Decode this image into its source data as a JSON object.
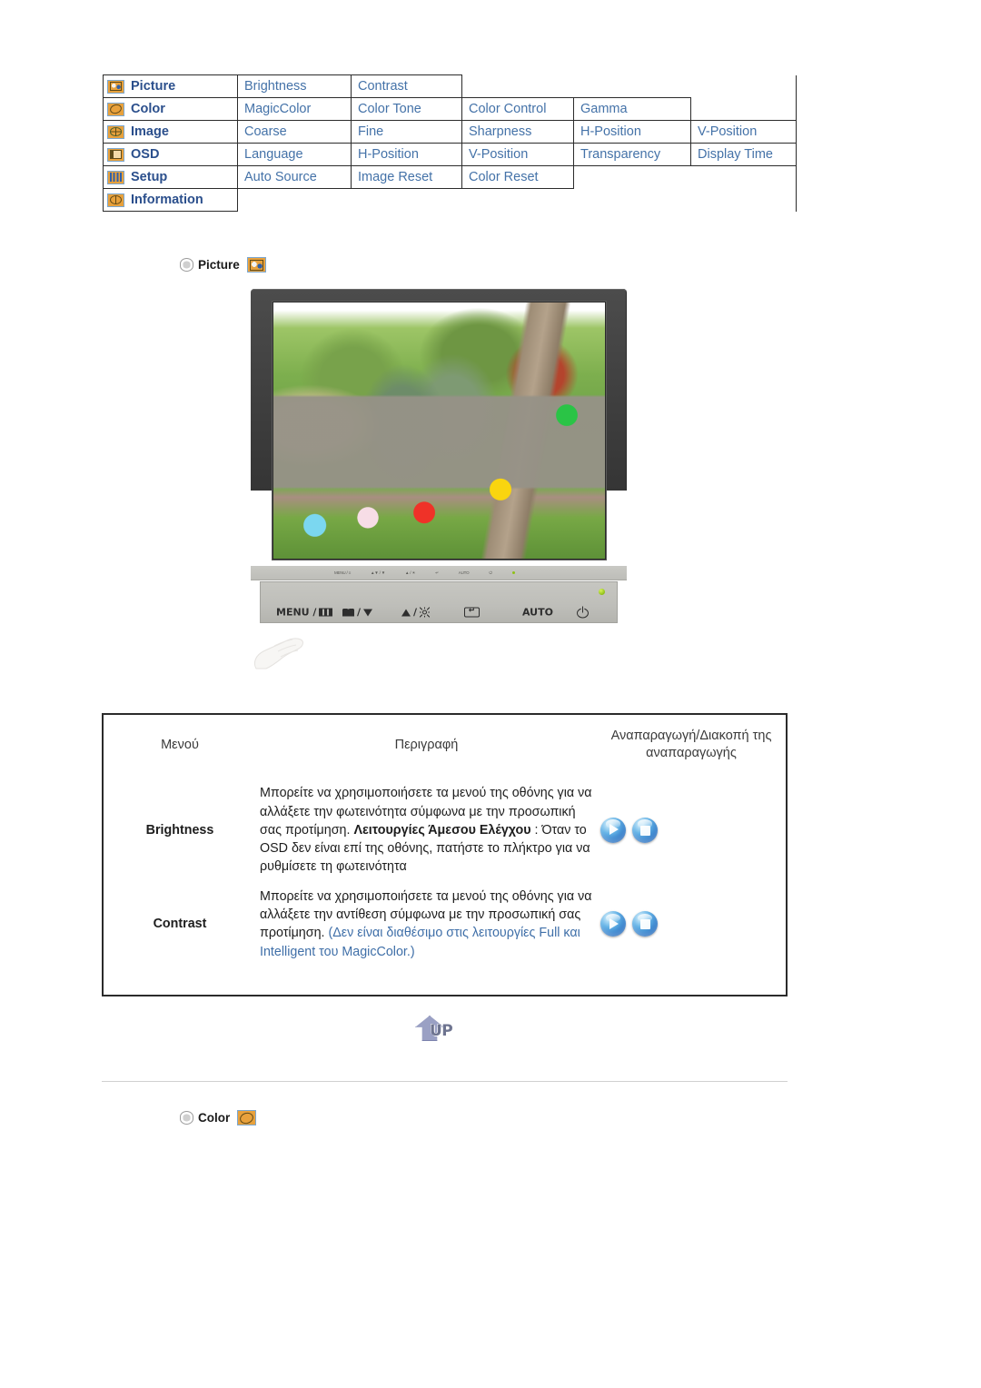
{
  "osd_menu": {
    "rows": [
      {
        "icon": "picture-icon",
        "category": "Picture",
        "items": [
          "Brightness",
          "Contrast"
        ]
      },
      {
        "icon": "color-icon",
        "category": "Color",
        "items": [
          "MagicColor",
          "Color Tone",
          "Color Control",
          "Gamma"
        ]
      },
      {
        "icon": "image-icon",
        "category": "Image",
        "items": [
          "Coarse",
          "Fine",
          "Sharpness",
          "H-Position",
          "V-Position"
        ]
      },
      {
        "icon": "osd-icon",
        "category": "OSD",
        "items": [
          "Language",
          "H-Position",
          "V-Position",
          "Transparency",
          "Display Time"
        ]
      },
      {
        "icon": "setup-icon",
        "category": "Setup",
        "items": [
          "Auto Source",
          "Image Reset",
          "Color Reset"
        ]
      },
      {
        "icon": "information-icon",
        "category": "Information",
        "items": []
      }
    ]
  },
  "section_picture": {
    "label": "Picture",
    "icon": "picture-icon"
  },
  "section_color": {
    "label": "Color",
    "icon": "color-icon"
  },
  "monitor": {
    "bezel_legend": [
      "MENU / ≡",
      "▲▼ / ▼",
      "▲ / ☀",
      "↵",
      "AUTO",
      "⏻"
    ],
    "buttons": [
      {
        "name": "menu-button",
        "label": "MENU /",
        "glyph": "menu-bars-icon"
      },
      {
        "name": "magicbright-down-button",
        "label": "/",
        "glyph": "magicbright-down-icon"
      },
      {
        "name": "brightness-up-button",
        "label": "/",
        "glyph": "brightness-up-icon"
      },
      {
        "name": "enter-button",
        "label": "",
        "glyph": "enter-icon"
      },
      {
        "name": "auto-button",
        "label": "AUTO",
        "glyph": ""
      },
      {
        "name": "power-button",
        "label": "",
        "glyph": "power-icon"
      }
    ],
    "power_led": "power-led-indicator"
  },
  "desc_table": {
    "headers": {
      "menu": "Μενού",
      "description": "Περιγραφή",
      "playstop": "Αναπαραγωγή/Διακοπή της αναπαραγωγής"
    },
    "rows": [
      {
        "name": "Brightness",
        "desc_plain_1": "Μπορείτε να χρησιμοποιήσετε τα μενού της οθόνης για να αλλάξετε την φωτεινότητα σύμφωνα με την προσωπική σας προτίμηση.",
        "desc_bold": "Λειτουργίες Άμεσου Ελέγχου",
        "desc_plain_2": " : Όταν το OSD δεν είναι επί της οθόνης, πατήστε το πλήκτρο για να ρυθμίσετε τη φωτεινότητα",
        "desc_blue": "",
        "controls": [
          "play-orb",
          "stop-orb"
        ]
      },
      {
        "name": "Contrast",
        "desc_plain_1": "Μπορείτε να χρησιμοποιήσετε τα μενού της οθόνης για να αλλάξετε την αντίθεση σύμφωνα με την προσωπική σας προτίμηση.",
        "desc_bold": "",
        "desc_plain_2": "",
        "desc_blue": "(Δεν είναι διαθέσιμο στις λειτουργίες Full και Intelligent του MagicColor.)",
        "controls": [
          "play-orb",
          "stop-orb"
        ]
      }
    ]
  },
  "up_button": {
    "label": "UP",
    "icon": "up-arrow-icon"
  },
  "colors": {
    "menu_text": "#4472a8",
    "category_text": "#2b4f8c",
    "icon_orange": "#e8a13c",
    "icon_border_blue": "#7ba7d0",
    "note_blue": "#3f6fa8",
    "orb_blue": "#2b74c4",
    "led_green": "#8fc018"
  }
}
